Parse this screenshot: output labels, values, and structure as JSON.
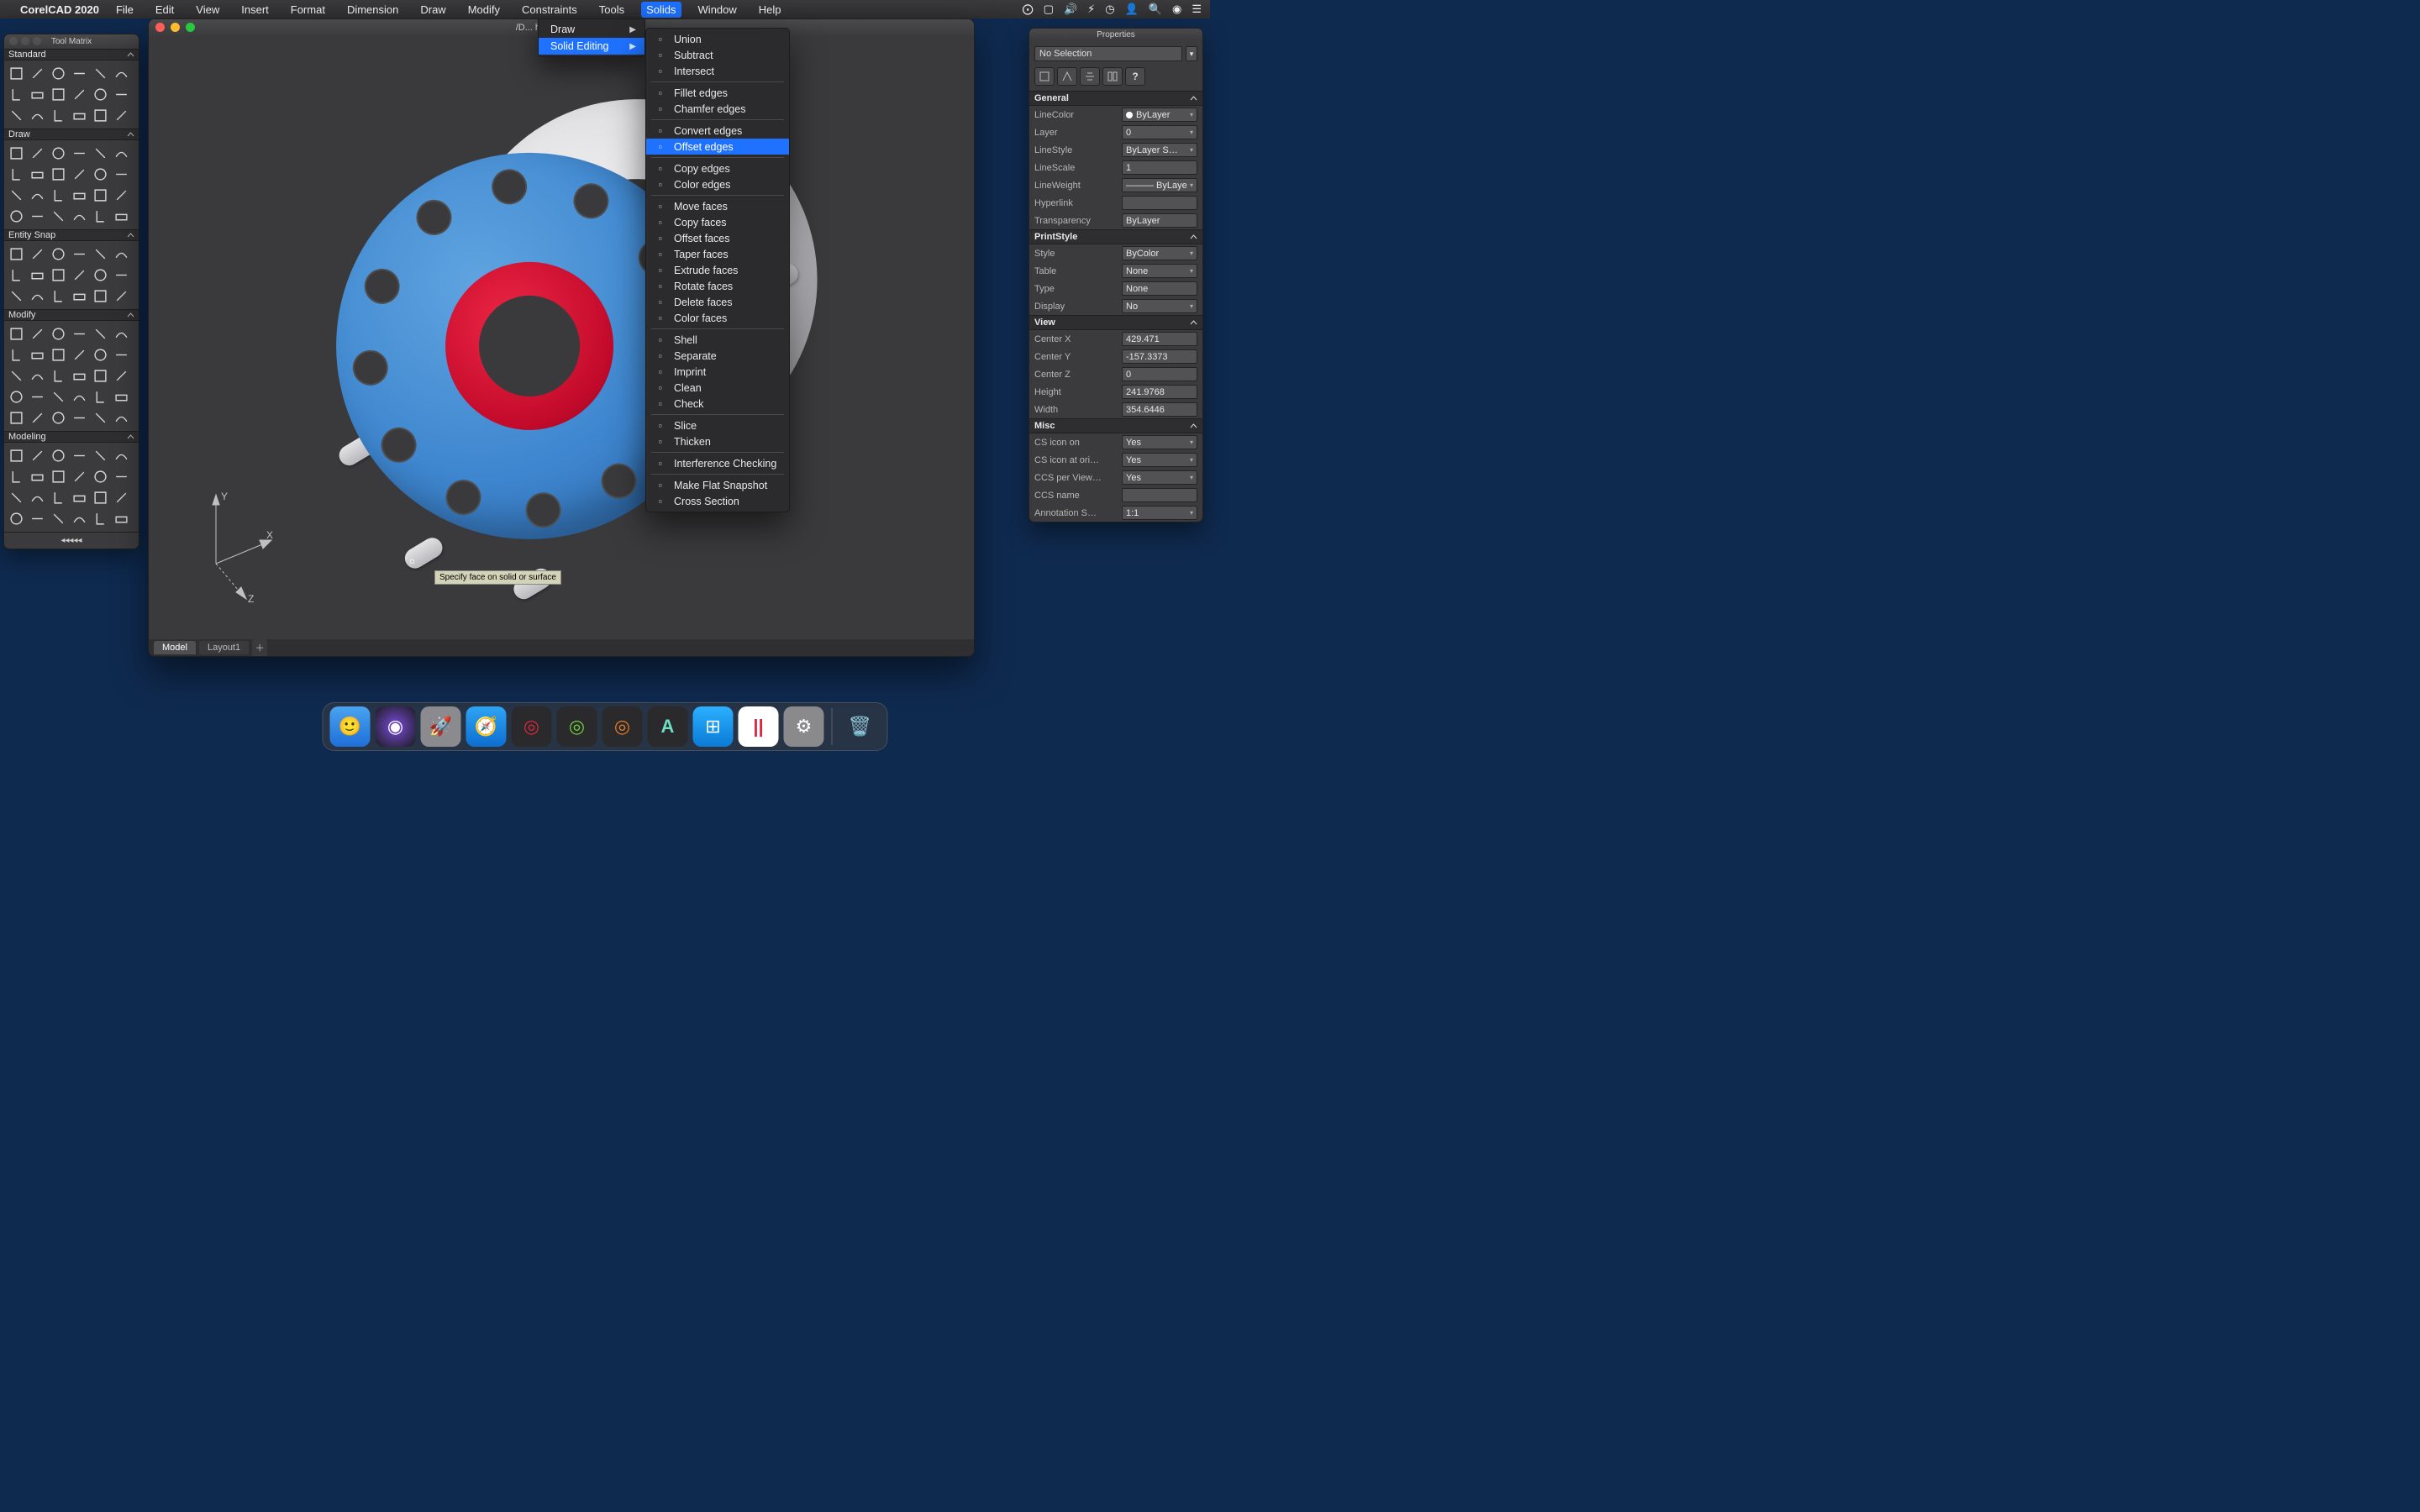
{
  "menubar": {
    "app": "CorelCAD 2020",
    "items": [
      "File",
      "Edit",
      "View",
      "Insert",
      "Format",
      "Dimension",
      "Draw",
      "Modify",
      "Constraints",
      "Tools",
      "Solids",
      "Window",
      "Help"
    ],
    "active": "Solids"
  },
  "submenu": {
    "items": [
      {
        "label": "Draw",
        "hasChildren": true
      },
      {
        "label": "Solid Editing",
        "hasChildren": true,
        "active": true
      }
    ]
  },
  "solid_editing_menu": {
    "groups": [
      [
        "Union",
        "Subtract",
        "Intersect"
      ],
      [
        "Fillet edges",
        "Chamfer edges"
      ],
      [
        "Convert edges",
        "Offset edges"
      ],
      [
        "Copy edges",
        "Color edges"
      ],
      [
        "Move faces",
        "Copy faces",
        "Offset faces",
        "Taper faces",
        "Extrude faces",
        "Rotate faces",
        "Delete faces",
        "Color faces"
      ],
      [
        "Shell",
        "Separate",
        "Imprint",
        "Clean",
        "Check"
      ],
      [
        "Slice",
        "Thicken"
      ],
      [
        "Interference Checking"
      ],
      [
        "Make Flat Snapshot",
        "Cross Section"
      ]
    ],
    "highlighted": "Offset edges"
  },
  "toolmatrix": {
    "title": "Tool Matrix",
    "sections": [
      {
        "name": "Standard",
        "iconCount": 18
      },
      {
        "name": "Draw",
        "iconCount": 24
      },
      {
        "name": "Entity Snap",
        "iconCount": 18
      },
      {
        "name": "Modify",
        "iconCount": 30
      },
      {
        "name": "Modeling",
        "iconCount": 24
      }
    ],
    "collapse": "◂◂◂◂◂"
  },
  "document": {
    "title": "/D...    heck Valve 2.dwg",
    "tabs": [
      "Model",
      "Layout1"
    ],
    "active_tab": "Model",
    "tooltip": "Specify face on solid or surface",
    "ucs": {
      "x": "X",
      "y": "Y",
      "z": "Z"
    }
  },
  "properties": {
    "title": "Properties",
    "selection": "No Selection",
    "help": "?",
    "sections": {
      "General": [
        {
          "label": "LineColor",
          "value": "ByLayer",
          "swatch": true,
          "dd": true
        },
        {
          "label": "Layer",
          "value": "0",
          "dd": true
        },
        {
          "label": "LineStyle",
          "value": "ByLayer   S…",
          "dd": true
        },
        {
          "label": "LineScale",
          "value": "1"
        },
        {
          "label": "LineWeight",
          "value": "——— ByLaye",
          "dd": true
        },
        {
          "label": "Hyperlink",
          "value": ""
        },
        {
          "label": "Transparency",
          "value": "ByLayer"
        }
      ],
      "PrintStyle": [
        {
          "label": "Style",
          "value": "ByColor",
          "dd": true
        },
        {
          "label": "Table",
          "value": "None",
          "dd": true
        },
        {
          "label": "Type",
          "value": "None"
        },
        {
          "label": "Display",
          "value": "No",
          "dd": true
        }
      ],
      "View": [
        {
          "label": "Center X",
          "value": "429.471"
        },
        {
          "label": "Center Y",
          "value": "-157.3373"
        },
        {
          "label": "Center Z",
          "value": "0"
        },
        {
          "label": "Height",
          "value": "241.9768"
        },
        {
          "label": "Width",
          "value": "354.6446"
        }
      ],
      "Misc": [
        {
          "label": "CS icon on",
          "value": "Yes",
          "dd": true
        },
        {
          "label": "CS icon at ori…",
          "value": "Yes",
          "dd": true
        },
        {
          "label": "CCS per View…",
          "value": "Yes",
          "dd": true
        },
        {
          "label": "CCS name",
          "value": ""
        },
        {
          "label": "Annotation S…",
          "value": "1:1",
          "dd": true
        }
      ]
    }
  },
  "dock": {
    "apps": [
      "finder",
      "siri",
      "launchpad",
      "safari",
      "corelcad",
      "coreldraw",
      "capture",
      "autocad",
      "windows",
      "parallels",
      "settings"
    ],
    "trash": "trash"
  }
}
